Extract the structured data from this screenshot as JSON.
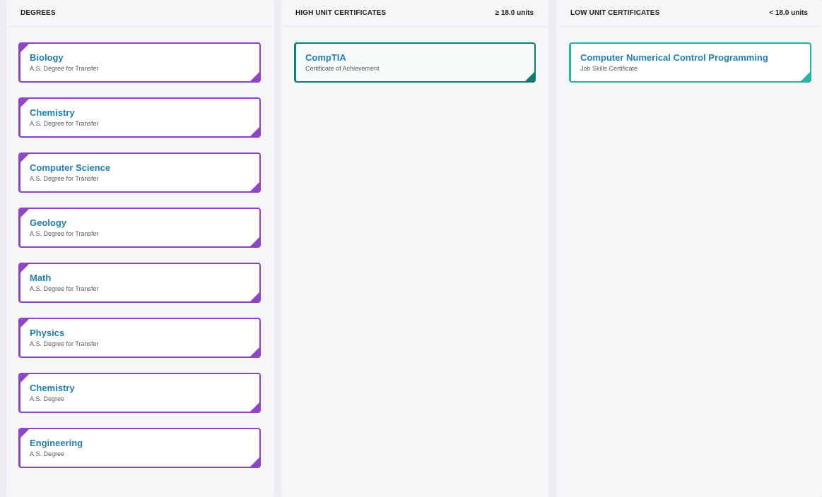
{
  "columns": {
    "degrees": {
      "title": "DEGREES",
      "items": [
        {
          "title": "Biology",
          "subtitle": "A.S. Degree for Transfer"
        },
        {
          "title": "Chemistry",
          "subtitle": "A.S. Degree for Transfer"
        },
        {
          "title": "Computer Science",
          "subtitle": "A.S. Degree for Transfer"
        },
        {
          "title": "Geology",
          "subtitle": "A.S. Degree for Transfer"
        },
        {
          "title": "Math",
          "subtitle": "A.S. Degree for Transfer"
        },
        {
          "title": "Physics",
          "subtitle": "A.S. Degree for Transfer"
        },
        {
          "title": "Chemistry",
          "subtitle": "A.S. Degree"
        },
        {
          "title": "Engineering",
          "subtitle": "A.S. Degree"
        }
      ]
    },
    "high_unit": {
      "title": "HIGH UNIT CERTIFICATES",
      "units": "≥ 18.0 units",
      "items": [
        {
          "title": "CompTIA",
          "subtitle": "Certificate of Achievement"
        }
      ]
    },
    "low_unit": {
      "title": "LOW UNIT CERTIFICATES",
      "units": "< 18.0 units",
      "items": [
        {
          "title": "Computer Numerical Control Programming",
          "subtitle": "Job Skills Certificate"
        }
      ]
    }
  },
  "colors": {
    "degree_accent": "#8e44c4",
    "high_cert_accent": "#137c70",
    "low_cert_accent": "#27b3a8",
    "title_link": "#1f7fb5"
  }
}
